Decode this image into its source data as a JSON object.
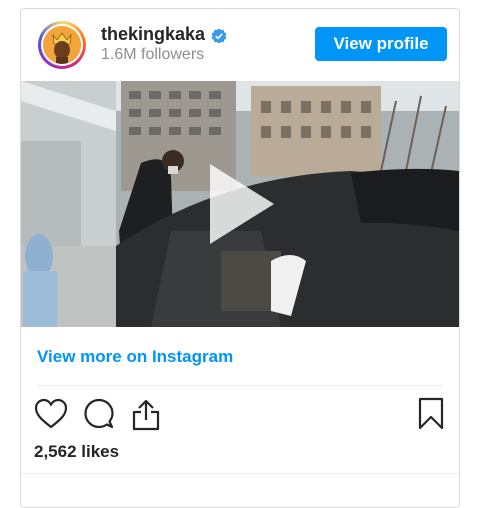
{
  "profile": {
    "username": "thekingkaka",
    "followers": "1.6M followers",
    "view_profile_label": "View profile"
  },
  "post": {
    "view_more_label": "View more on Instagram",
    "likes": "2,562 likes"
  },
  "icons": [
    "verified-badge-icon",
    "play-icon",
    "heart-icon",
    "comment-icon",
    "share-icon",
    "bookmark-icon"
  ],
  "colors": {
    "accent": "#0095f6",
    "text": "#262626",
    "muted": "#8e8e8e"
  }
}
